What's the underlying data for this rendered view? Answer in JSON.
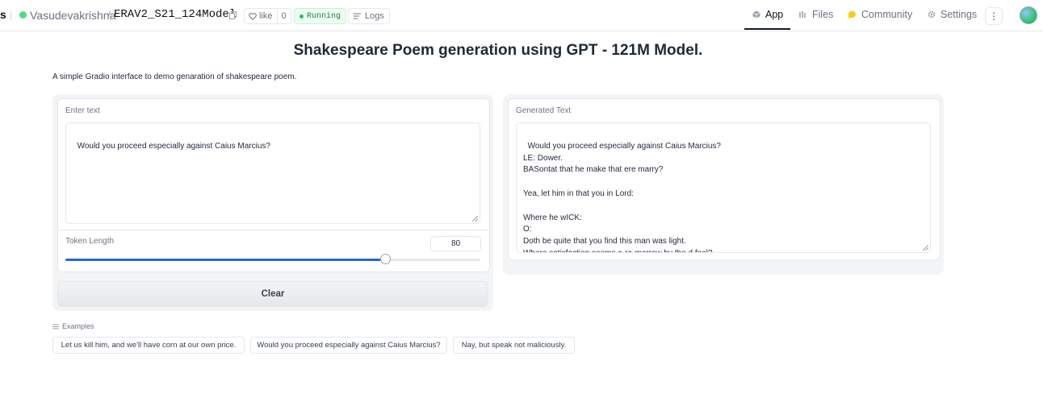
{
  "header": {
    "brand_fragment": "s",
    "owner": "Vasudevakrishna",
    "separator": "/",
    "repo": "ERAV2_S21_124Model",
    "like_label": "like",
    "like_count": "0",
    "status": "Running",
    "logs_label": "Logs",
    "nav": {
      "app": "App",
      "files": "Files",
      "community": "Community",
      "settings": "Settings"
    }
  },
  "main": {
    "title": "Shakespeare Poem generation using GPT - 121M Model.",
    "description": "A simple Gradio interface to demo genaration of shakespeare poem.",
    "input": {
      "label": "Enter text",
      "value": "Would you proceed especially against Caius Marcius?"
    },
    "token_length": {
      "label": "Token Length",
      "value": "80",
      "fraction": 0.77
    },
    "clear_label": "Clear",
    "output": {
      "label": "Generated Text",
      "value": "Would you proceed especially against Caius Marcius?\nLE: Dower.\nBASontat that he make that ere marry?\n\nYea, let him in that you in Lord:\n\nWhere he wICK:\nO:\nDoth be quite that you find this man was light.\nWhere satisfaction seems a-ra-morrow by the d fool?"
    },
    "examples": {
      "label": "Examples",
      "items": [
        "Let us kill him, and we'll have corn at our own price.",
        "Would you proceed especially against Caius Marcius?",
        "Nay, but speak not maliciously."
      ]
    }
  },
  "colors": {
    "accent": "#2563eb",
    "running_green": "#22c55e",
    "panel_bg": "#f3f4f6"
  }
}
